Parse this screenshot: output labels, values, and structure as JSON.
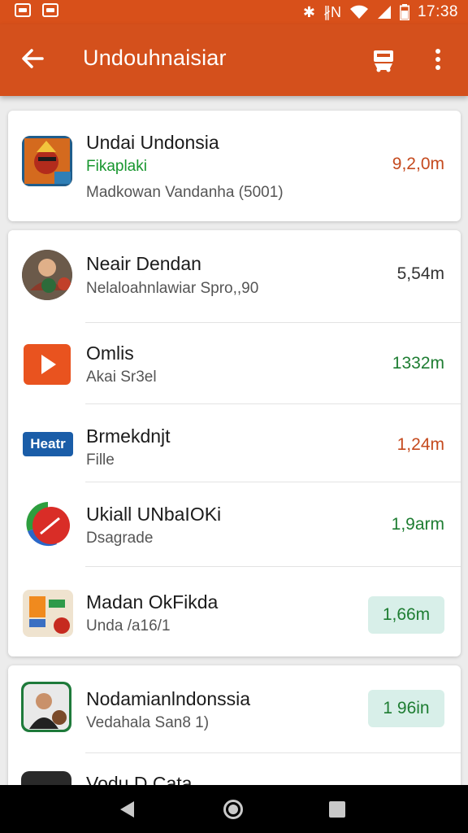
{
  "status_bar": {
    "time": "17:38",
    "signal": "∦N"
  },
  "app_bar": {
    "title": "Undouhnaisiar"
  },
  "featured": {
    "title": "Undai Undonsia",
    "subtitle": "Fikaplaki",
    "detail": "Madkowan Vandanha (5001)",
    "size": "9,2,0m"
  },
  "apps": [
    {
      "title": "Neair Dendan",
      "subtitle": "Nelaloahnlawiar Spro,,90",
      "size": "5,54m"
    },
    {
      "title": "Omlis",
      "subtitle": "Akai Sr3el",
      "size": "1332m"
    },
    {
      "title": "Brmekdnjt",
      "subtitle": "Fille",
      "size": "1,24m",
      "icon_text": "Heatr"
    },
    {
      "title": "Ukiall UNbaIOKi",
      "subtitle": "Dsagrade",
      "size": "1,9arm"
    },
    {
      "title": "Madan OkFikda",
      "subtitle": "Unda /a16/1",
      "size": "1,66m"
    }
  ],
  "more_apps": [
    {
      "title": "Nodamianlndonssia",
      "subtitle": "Vedahala San8 1)",
      "size": "1 96in"
    },
    {
      "title": "Vodu D Cata"
    }
  ],
  "colors": {
    "primary": "#d4501c",
    "status": "#d8501a",
    "size_red": "#c54a1e",
    "size_green": "#1e7d32",
    "pill_bg": "#d8efe9"
  }
}
